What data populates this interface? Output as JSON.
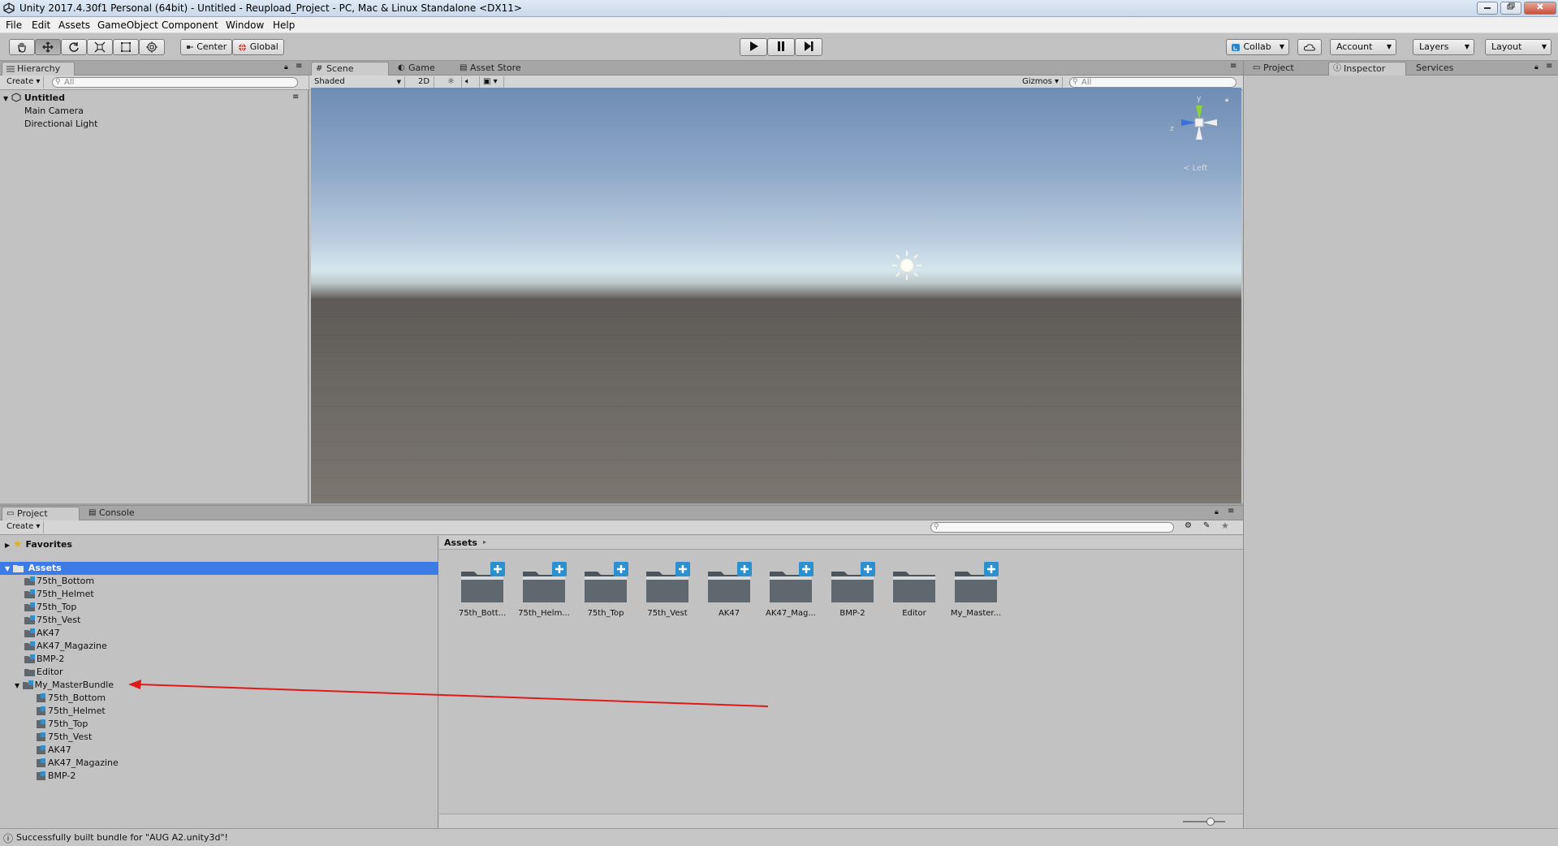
{
  "window": {
    "title": "Unity 2017.4.30f1 Personal (64bit) - Untitled - Reupload_Project - PC, Mac & Linux Standalone <DX11>",
    "controls": [
      "minimize",
      "maximize",
      "close"
    ]
  },
  "menu": [
    "File",
    "Edit",
    "Assets",
    "GameObject",
    "Component",
    "Window",
    "Help"
  ],
  "toolbar": {
    "tools": [
      "hand-tool",
      "move-tool",
      "rotate-tool",
      "scale-tool",
      "rect-tool",
      "transform-tool"
    ],
    "pivot": "Center",
    "space": "Global",
    "play": "play",
    "pause": "pause",
    "step": "step",
    "collab": "Collab",
    "account": "Account",
    "layers": "Layers",
    "layout": "Layout"
  },
  "hierarchy": {
    "tab": "Hierarchy",
    "create": "Create",
    "search_placeholder": "All",
    "scene": "Untitled",
    "items": [
      "Main Camera",
      "Directional Light"
    ]
  },
  "scene": {
    "tabs": [
      "Scene",
      "Game",
      "Asset Store"
    ],
    "shading": "Shaded",
    "mode_2d": "2D",
    "gizmos": "Gizmos",
    "search_placeholder": "All",
    "gizmo_axes": {
      "y": "y",
      "z": "z"
    },
    "view_label": "Left"
  },
  "inspector": {
    "tabs": [
      "Project",
      "Inspector",
      "Services"
    ]
  },
  "project": {
    "tabs": [
      "Project",
      "Console"
    ],
    "create": "Create",
    "favorites": "Favorites",
    "assets_root": "Assets",
    "tree": [
      "75th_Bottom",
      "75th_Helmet",
      "75th_Top",
      "75th_Vest",
      "AK47",
      "AK47_Magazine",
      "BMP-2",
      "Editor",
      "My_MasterBundle"
    ],
    "subtree": [
      "75th_Bottom",
      "75th_Helmet",
      "75th_Top",
      "75th_Vest",
      "AK47",
      "AK47_Magazine",
      "BMP-2"
    ],
    "breadcrumb": "Assets",
    "grid": [
      {
        "label": "75th_Bott...",
        "bundle": true
      },
      {
        "label": "75th_Helm...",
        "bundle": true
      },
      {
        "label": "75th_Top",
        "bundle": true
      },
      {
        "label": "75th_Vest",
        "bundle": true
      },
      {
        "label": "AK47",
        "bundle": true
      },
      {
        "label": "AK47_Mag...",
        "bundle": true
      },
      {
        "label": "BMP-2",
        "bundle": true
      },
      {
        "label": "Editor",
        "bundle": false
      },
      {
        "label": "My_Master...",
        "bundle": true
      }
    ]
  },
  "status": {
    "message": "Successfully built bundle for \"AUG A2.unity3d\"!"
  },
  "colors": {
    "selection": "#3d7ce6",
    "annotation_arrow": "#e01a1a",
    "bundle_badge": "#2b8fd0"
  }
}
